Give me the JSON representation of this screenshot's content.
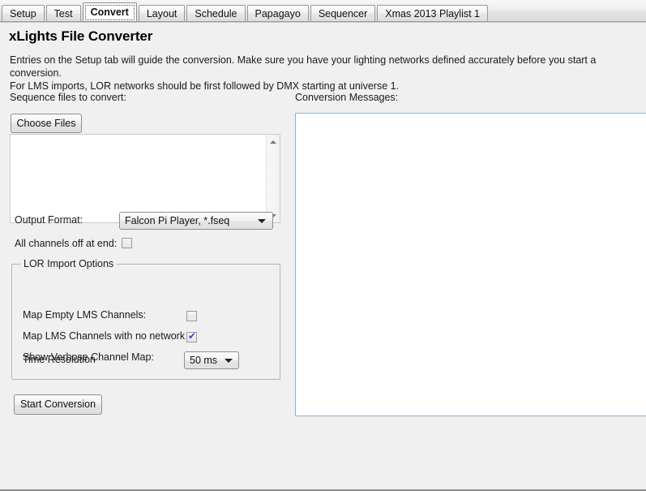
{
  "tabs": [
    {
      "label": "Setup",
      "active": false
    },
    {
      "label": "Test",
      "active": false
    },
    {
      "label": "Convert",
      "active": true
    },
    {
      "label": "Layout",
      "active": false
    },
    {
      "label": "Schedule",
      "active": false
    },
    {
      "label": "Papagayo",
      "active": false
    },
    {
      "label": "Sequencer",
      "active": false
    },
    {
      "label": "Xmas 2013 Playlist 1",
      "active": false
    }
  ],
  "page": {
    "title": "xLights File Converter",
    "description_line1": "Entries on the Setup tab will guide the conversion. Make sure you have your lighting networks defined accurately before you start a conversion.",
    "description_line2": "For LMS imports, LOR networks should be first followed by DMX starting at universe 1."
  },
  "left": {
    "sequence_files_label": "Sequence files to convert:",
    "choose_files_label": "Choose Files",
    "file_list_value": "",
    "output_format_label": "Output Format:",
    "output_format_value": "Falcon Pi Player, *.fseq",
    "all_channels_off_label": "All channels off at end:",
    "all_channels_off_checked": false,
    "start_conversion_label": "Start Conversion"
  },
  "lor_group": {
    "title": "LOR Import Options",
    "map_empty_label": "Map Empty LMS Channels:",
    "map_empty_checked": false,
    "map_no_network_label": "Map LMS Channels with no network",
    "map_no_network_checked": true,
    "verbose_label": "Show Verbose Channel Map:",
    "verbose_checked": false,
    "time_resolution_label": "Time Resolution",
    "time_resolution_value": "50 ms"
  },
  "right": {
    "conversion_messages_label": "Conversion Messages:",
    "conversion_messages_value": ""
  },
  "checkmark_glyph": "✔",
  "colors": {
    "window_background": "#f0f0f0",
    "field_background": "#ffffff",
    "check_color": "#2a4fb5",
    "msgbox_border": "#8fb4d4"
  }
}
